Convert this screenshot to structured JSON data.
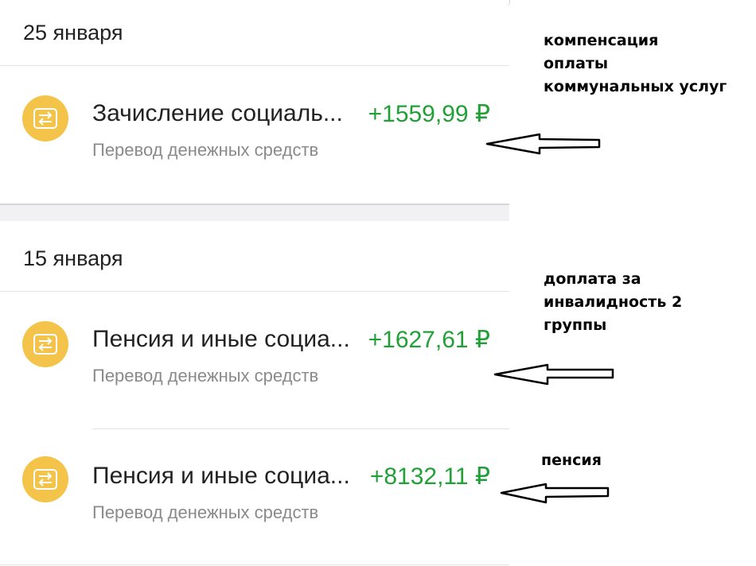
{
  "sections": [
    {
      "date": "25 января",
      "transactions": [
        {
          "title": "Зачисление социаль...",
          "amount": "+1559,99 ₽",
          "subtitle": "Перевод денежных средств",
          "icon": "transfer-arrows-icon"
        }
      ]
    },
    {
      "date": "15 января",
      "transactions": [
        {
          "title": "Пенсия и иные социа...",
          "amount": "+1627,61 ₽",
          "subtitle": "Перевод денежных средств",
          "icon": "transfer-arrows-icon"
        },
        {
          "title": "Пенсия и иные социа...",
          "amount": "+8132,11 ₽",
          "subtitle": "Перевод денежных средств",
          "icon": "transfer-arrows-icon"
        }
      ]
    }
  ],
  "annotations": [
    {
      "lines": [
        "компенсация",
        "оплаты",
        "коммунальных услуг"
      ]
    },
    {
      "lines": [
        "доплата за",
        "инвалидность 2",
        "группы"
      ]
    },
    {
      "lines": [
        "пенсия"
      ]
    }
  ],
  "colors": {
    "amount": "#21a038",
    "icon_bg": "#f3c34a",
    "subtitle": "#8a8a8a",
    "title": "#222222"
  }
}
